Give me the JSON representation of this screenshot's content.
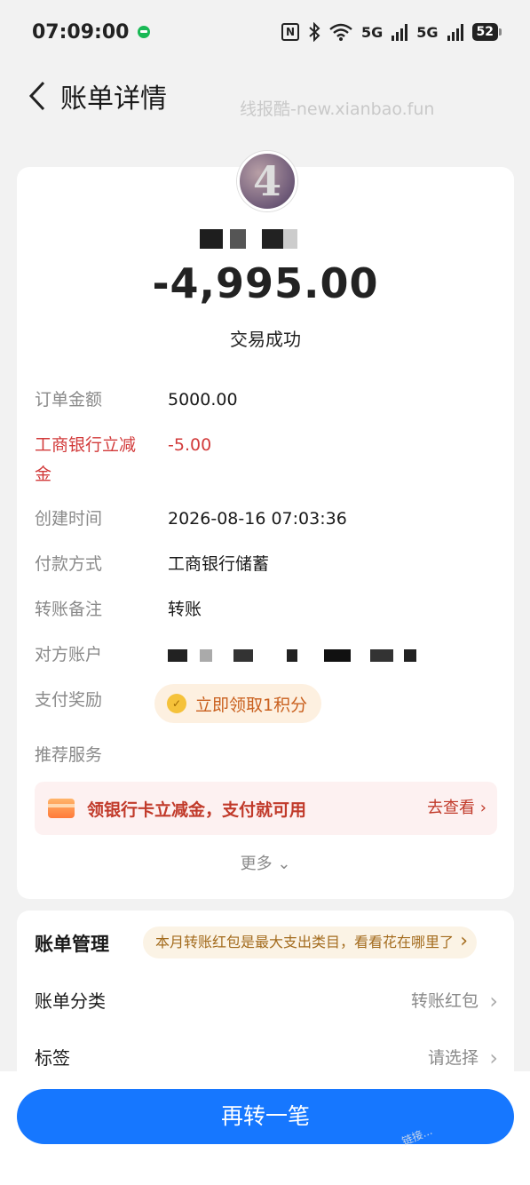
{
  "status_bar": {
    "time": "07:09:00",
    "network": "5G",
    "network2": "5G",
    "battery": "52"
  },
  "header": {
    "title": "账单详情",
    "watermark": "线报酷-new.xianbao.fun"
  },
  "summary": {
    "avatar_text": "4",
    "amount": "-4,995.00",
    "status": "交易成功"
  },
  "details": [
    {
      "label": "订单金额",
      "value": "5000.00"
    },
    {
      "label": "工商银行立减金",
      "value": "-5.00"
    },
    {
      "label": "创建时间",
      "value": "2026-08-16 07:03:36"
    },
    {
      "label": "付款方式",
      "value": "工商银行储蓄"
    },
    {
      "label": "转账备注",
      "value": "转账"
    },
    {
      "label": "对方账户",
      "value": ""
    },
    {
      "label": "支付奖励",
      "value": "立即领取1积分"
    },
    {
      "label": "推荐服务",
      "value": ""
    }
  ],
  "promo": {
    "text": "领银行卡立减金，支付就可用",
    "link": "去查看"
  },
  "more": "更多",
  "manage": {
    "title": "账单管理",
    "tip": "本月转账红包是最大支出类目，看看花在哪里了",
    "rows": [
      {
        "label": "账单分类",
        "value": "转账红包"
      },
      {
        "label": "标签",
        "value": "请选择"
      }
    ]
  },
  "primary_button": "再转一笔",
  "corner_mark": "链接..."
}
